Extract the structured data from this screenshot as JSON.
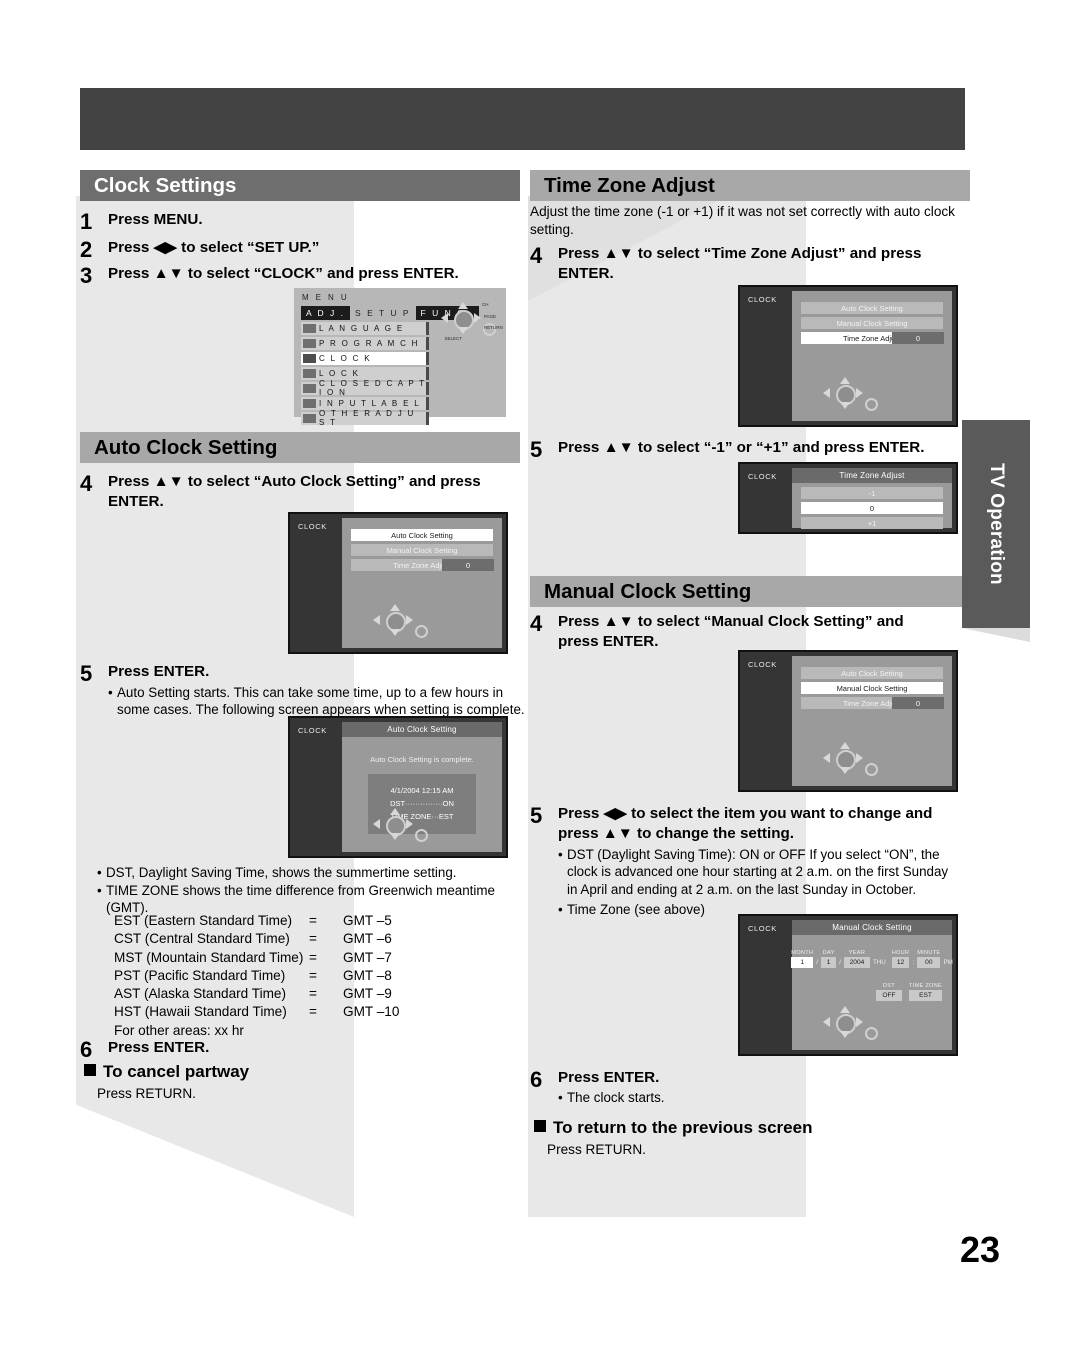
{
  "page": {
    "number": "23",
    "side_tab": "TV Operation"
  },
  "left_column": {
    "section1": {
      "title": "Clock Settings",
      "steps": [
        {
          "num": "1",
          "text": "Press MENU."
        },
        {
          "num": "2",
          "text": "Press ◀▶ to select “SET UP.”"
        },
        {
          "num": "3",
          "text": "Press ▲▼ to select “CLOCK” and press ENTER."
        }
      ],
      "menu_screen": {
        "label": "M E N U",
        "tabs": [
          {
            "text": "A D J .",
            "active": true
          },
          {
            "text": "S E T  U P",
            "active": false
          },
          {
            "text": "F U N C .",
            "active": true
          }
        ],
        "rows": [
          {
            "text": "L A N G U A G E",
            "selected": false
          },
          {
            "text": "P R O G R A M   C H",
            "selected": false
          },
          {
            "text": "C L O C K",
            "selected": true
          },
          {
            "text": "L O C K",
            "selected": false
          },
          {
            "text": "C L O S E D   C A P T I O N",
            "selected": false
          },
          {
            "text": "I N P U T   L A B E L",
            "selected": false
          },
          {
            "text": "O T H E R   A D J U S T",
            "selected": false
          }
        ],
        "dpad_labels": [
          "CH",
          "PAGE",
          "RETURN"
        ],
        "select_label": "SELECT"
      }
    },
    "section2": {
      "title": "Auto Clock Setting",
      "step4": {
        "num": "4",
        "text": "Press ▲▼ to select “Auto Clock Setting” and press ENTER."
      },
      "clock_screen": {
        "tag": "CLOCK",
        "options": [
          {
            "label": "Auto Clock Setting",
            "selected": true,
            "value": null
          },
          {
            "label": "Manual Clock Setting",
            "selected": false,
            "value": null
          },
          {
            "label": "Time Zone Adjust",
            "selected": false,
            "value": "0"
          }
        ]
      },
      "step5": {
        "num": "5",
        "text": "Press ENTER.",
        "bullets": [
          "Auto Setting starts. This can take some time, up to a few hours in some cases. The following screen appears when setting is complete."
        ]
      },
      "complete_screen": {
        "tag": "CLOCK",
        "title": "Auto Clock Setting",
        "message": "Auto Clock Setting is complete.",
        "info": [
          "4/1/2004 12:15 AM",
          "DST···············ON",
          "TIME ZONE···EST"
        ]
      },
      "notes": [
        "DST, Daylight Saving Time, shows the summertime setting.",
        "TIME ZONE shows the time difference from Greenwich meantime (GMT)."
      ],
      "timezone_table": [
        {
          "name": "EST (Eastern Standard Time)",
          "eq": "=",
          "gmt": "GMT –5"
        },
        {
          "name": "CST (Central Standard Time)",
          "eq": "=",
          "gmt": "GMT –6"
        },
        {
          "name": "MST (Mountain Standard Time)",
          "eq": "=",
          "gmt": "GMT –7"
        },
        {
          "name": "PST (Pacific Standard Time)",
          "eq": "=",
          "gmt": "GMT –8"
        },
        {
          "name": "AST (Alaska Standard Time)",
          "eq": "=",
          "gmt": "GMT –9"
        },
        {
          "name": "HST (Hawaii Standard Time)",
          "eq": "=",
          "gmt": "GMT –10"
        }
      ],
      "other_areas": "For other areas: xx hr",
      "step6": {
        "num": "6",
        "text": "Press ENTER."
      },
      "cancel_heading": "To cancel partway",
      "cancel_body": "Press RETURN."
    }
  },
  "right_column": {
    "section1": {
      "title": "Time Zone Adjust",
      "intro": "Adjust the time zone (-1 or +1) if it was not set correctly with auto clock setting.",
      "step4": {
        "num": "4",
        "text": "Press ▲▼ to select “Time Zone Adjust” and press ENTER."
      },
      "clock_screen": {
        "tag": "CLOCK",
        "options": [
          {
            "label": "Auto Clock Setting",
            "selected": false,
            "value": null
          },
          {
            "label": "Manual Clock Setting",
            "selected": false,
            "value": null
          },
          {
            "label": "Time Zone Adjust",
            "selected": true,
            "value": "0"
          }
        ]
      },
      "step5": {
        "num": "5",
        "text": "Press ▲▼ to select “-1” or “+1” and press ENTER."
      },
      "tz_screen": {
        "tag": "CLOCK",
        "title": "Time Zone Adjust",
        "options": [
          {
            "label": "-1",
            "selected": false
          },
          {
            "label": "0",
            "selected": true
          },
          {
            "label": "+1",
            "selected": false
          }
        ]
      }
    },
    "section2": {
      "title": "Manual Clock Setting",
      "step4": {
        "num": "4",
        "text": "Press ▲▼ to select “Manual Clock Setting” and press ENTER."
      },
      "clock_screen": {
        "tag": "CLOCK",
        "options": [
          {
            "label": "Auto Clock Setting",
            "selected": false,
            "value": null
          },
          {
            "label": "Manual Clock Setting",
            "selected": true,
            "value": null
          },
          {
            "label": "Time Zone Adjust",
            "selected": false,
            "value": "0"
          }
        ]
      },
      "step5": {
        "num": "5",
        "text": "Press ◀▶ to select the item you want to change and press ▲▼ to change the setting.",
        "bullets": [
          "DST (Daylight Saving Time): ON or OFF If you select “ON”, the clock is advanced one hour starting at 2 a.m. on the first Sunday in April and ending at 2 a.m. on the last Sunday in October.",
          "Time Zone (see above)"
        ]
      },
      "manual_screen": {
        "tag": "CLOCK",
        "title": "Manual Clock Setting",
        "fields": [
          {
            "caption": "MONTH",
            "value": "1",
            "selected": true
          },
          {
            "caption": "DAY",
            "value": "1",
            "selected": false
          },
          {
            "caption": "YEAR",
            "value": "2004",
            "selected": false
          },
          {
            "caption": "HOUR",
            "value": "12",
            "selected": false
          },
          {
            "caption": "MINUTE",
            "value": "00",
            "selected": false
          }
        ],
        "weekday": "THU",
        "meridiem": "PM",
        "sep_date": "/",
        "sep_time": ":",
        "dst": {
          "caption": "DST",
          "value": "OFF"
        },
        "timezone": {
          "caption": "TIME ZONE",
          "value": "EST"
        }
      },
      "step6": {
        "num": "6",
        "text": "Press ENTER.",
        "bullets": [
          "The clock starts."
        ]
      },
      "return_heading": "To return to the previous screen",
      "return_body": "Press RETURN."
    }
  }
}
